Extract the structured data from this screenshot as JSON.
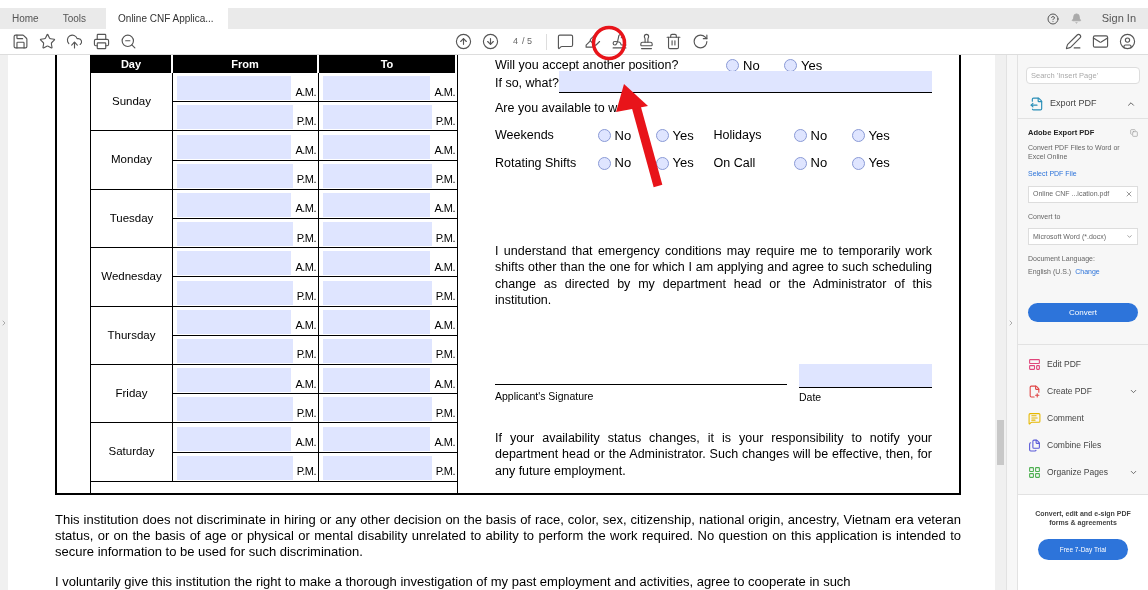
{
  "tabs": [
    {
      "label": "Home",
      "selected": false
    },
    {
      "label": "Tools",
      "selected": false
    },
    {
      "label": "Online CNF Applica...",
      "selected": true
    }
  ],
  "account": {
    "sign_in": "Sign In"
  },
  "toolbar": {
    "page": "4",
    "page_total": "/ 5"
  },
  "schedule": {
    "columns": [
      "Day",
      "From",
      "To"
    ],
    "days": [
      {
        "name": "Sunday",
        "from": [
          "A.M.",
          "P.M."
        ],
        "to": [
          "A.M.",
          "P.M."
        ]
      },
      {
        "name": "Monday",
        "from": [
          "A.M.",
          "P.M."
        ],
        "to": [
          "A.M.",
          "P.M."
        ]
      },
      {
        "name": "Tuesday",
        "from": [
          "A.M.",
          "P.M."
        ],
        "to": [
          "A.M.",
          "P.M."
        ]
      },
      {
        "name": "Wednesday",
        "from": [
          "A.M.",
          "P.M."
        ],
        "to": [
          "A.M.",
          "P.M."
        ]
      },
      {
        "name": "Thursday",
        "from": [
          "A.M.",
          "P.M."
        ],
        "to": [
          "A.M.",
          "P.M."
        ]
      },
      {
        "name": "Friday",
        "from": [
          "A.M.",
          "P.M."
        ],
        "to": [
          "A.M.",
          "P.M."
        ]
      },
      {
        "name": "Saturday",
        "from": [
          "A.M.",
          "P.M."
        ],
        "to": [
          "A.M.",
          "P.M."
        ]
      }
    ]
  },
  "form": {
    "another_position": {
      "question": "Will you accept another position?",
      "options": [
        {
          "label": "No",
          "selected": false
        },
        {
          "label": "Yes",
          "selected": false
        }
      ]
    },
    "if_so": "If so, what?",
    "available": "Are you available to w",
    "availability": [
      {
        "label": "Weekends",
        "options": [
          {
            "label": "No",
            "selected": false
          },
          {
            "label": "Yes",
            "selected": false
          }
        ]
      },
      {
        "label": "Holidays",
        "options": [
          {
            "label": "No",
            "selected": false
          },
          {
            "label": "Yes",
            "selected": false
          }
        ]
      },
      {
        "label": "Rotating Shifts",
        "options": [
          {
            "label": "No",
            "selected": false
          },
          {
            "label": "Yes",
            "selected": false
          }
        ]
      },
      {
        "label": "On Call",
        "options": [
          {
            "label": "No",
            "selected": false
          },
          {
            "label": "Yes",
            "selected": false
          }
        ]
      }
    ],
    "emergency": "I understand that emergency conditions may require me to temporarily work shifts other than the one for which I am applying and agree to such scheduling change as directed by my department head or the Administrator of this institution.",
    "signature_label": "Applicant's Signature",
    "date_label": "Date",
    "status_note": "If your availability status changes, it is your responsibility to notify your department head or the Administrator. Such changes will be effective, then, for any future employment."
  },
  "footer_paragraphs": [
    "This institution does not discriminate in hiring or any other decision on the basis of race, color, sex, citizenship, national origin, ancestry, Vietnam era veteran status, or on the basis of age or physical or mental disability unrelated to ability to perform the work required. No question on this application is intended to secure information to be used for such discrimination.",
    "I voluntarily give this institution the right to make a thorough investigation of my past employment and activities, agree to cooperate in such"
  ],
  "panel": {
    "search_placeholder": "Search 'Insert Page'",
    "export": {
      "title": "Export PDF",
      "expanded": true,
      "heading": "Adobe Export PDF",
      "description": "Convert PDF Files to Word or Excel Online",
      "select_label": "Select PDF File",
      "file": "Online CNF ...ication.pdf",
      "convert_to_label": "Convert to",
      "format": "Microsoft Word (*.docx)",
      "language_label": "Document Language:",
      "language": "English (U.S.)",
      "change": "Change",
      "convert": "Convert"
    },
    "tools": [
      {
        "kind": "edit",
        "label": "Edit PDF",
        "expandable": false
      },
      {
        "kind": "create",
        "label": "Create PDF",
        "expandable": true
      },
      {
        "kind": "comment",
        "label": "Comment",
        "expandable": false
      },
      {
        "kind": "combine",
        "label": "Combine Files",
        "expandable": false
      },
      {
        "kind": "organize",
        "label": "Organize Pages",
        "expandable": true
      }
    ],
    "promo": "Convert, edit and e-sign PDF forms & agreements",
    "trial": "Free 7-Day Trial"
  }
}
